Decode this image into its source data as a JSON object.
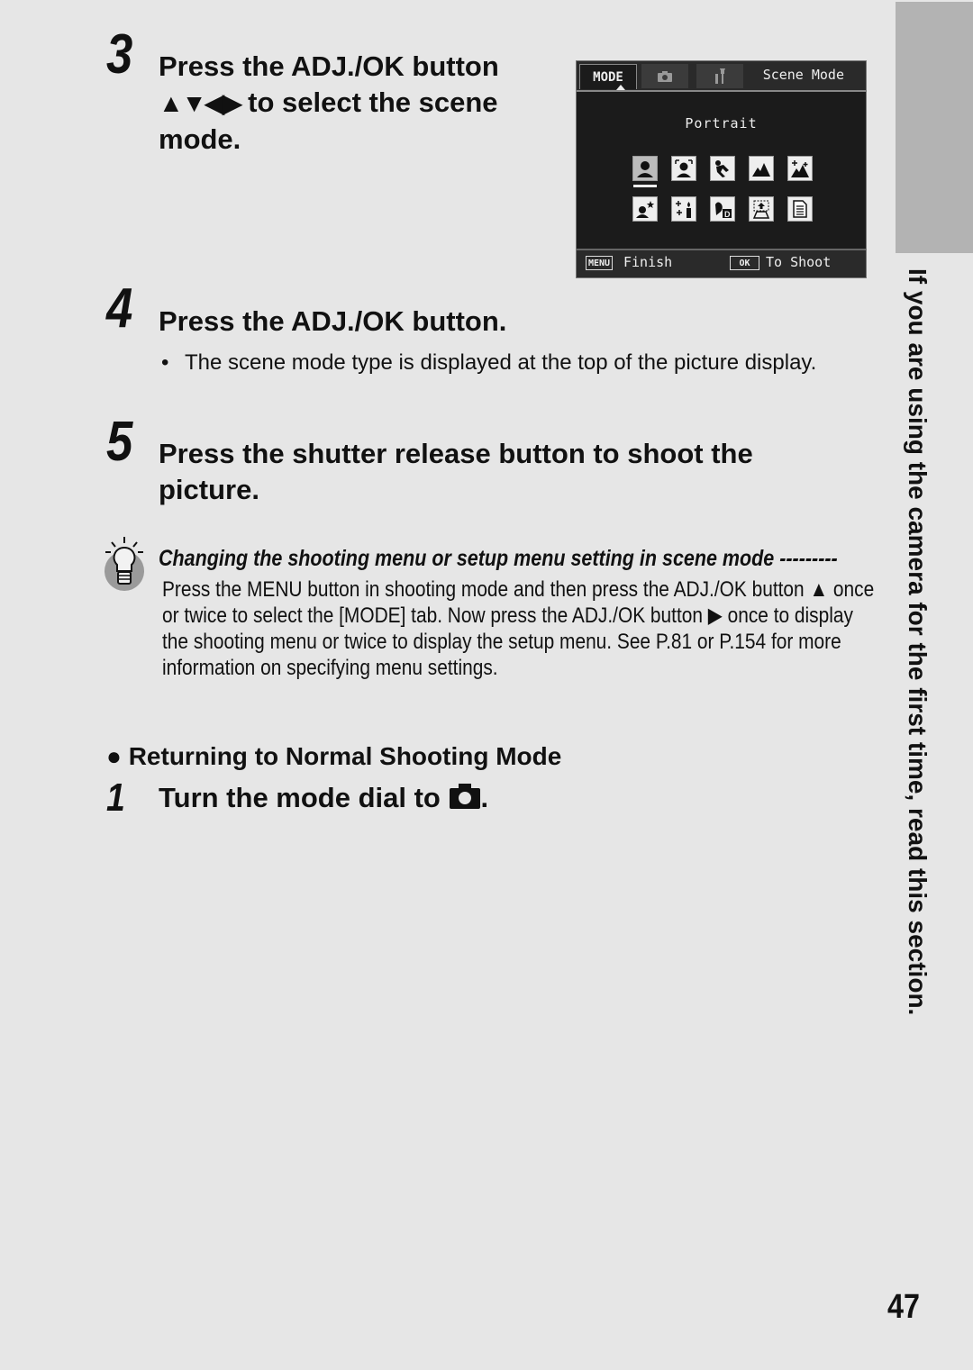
{
  "steps": [
    {
      "number": "3",
      "lines": [
        "Press the ADJ./OK button",
        "to select the scene",
        "mode."
      ],
      "arrows": "▲▼◀▶"
    },
    {
      "number": "4",
      "text": "Press the ADJ./OK button.",
      "bullet": "The scene mode type is displayed at the top of the picture display."
    },
    {
      "number": "5",
      "lines": [
        "Press the shutter release button to shoot the",
        "picture."
      ]
    }
  ],
  "camera_screen": {
    "tabs": [
      {
        "label": "MODE",
        "icon": "mode-tab",
        "active": true
      },
      {
        "label": "",
        "icon": "camera-icon",
        "active": false
      },
      {
        "label": "",
        "icon": "wrench-icon",
        "active": false
      }
    ],
    "title": "Scene Mode",
    "selected_mode": "Portrait",
    "scene_icons": [
      "portrait",
      "face-portrait",
      "sports",
      "landscape",
      "night-scene",
      "high-sensitivity",
      "candlelight",
      "zoom-macro",
      "skew-correction",
      "text-mode"
    ],
    "footer": {
      "menu_key": "MENU",
      "menu_label": "Finish",
      "ok_key": "OK",
      "ok_label": "To Shoot"
    }
  },
  "tip": {
    "title": "Changing the shooting menu or setup menu setting in scene mode ---------",
    "lines": [
      "Press the MENU button in shooting mode and then press the ADJ./OK button ▲ once",
      "or twice to select the [MODE] tab. Now press the ADJ./OK button ▶ once to display",
      "the shooting menu or twice to display the setup menu. See P.81 or P.154 for more",
      "information on specifying menu settings."
    ]
  },
  "returning": {
    "subheading": "Returning to Normal Shooting Mode",
    "step_number": "1",
    "step_text": "Turn the mode dial to",
    "step_end": "."
  },
  "side_tab": "If you are using the camera for the first time, read this section.",
  "page_number": "47"
}
